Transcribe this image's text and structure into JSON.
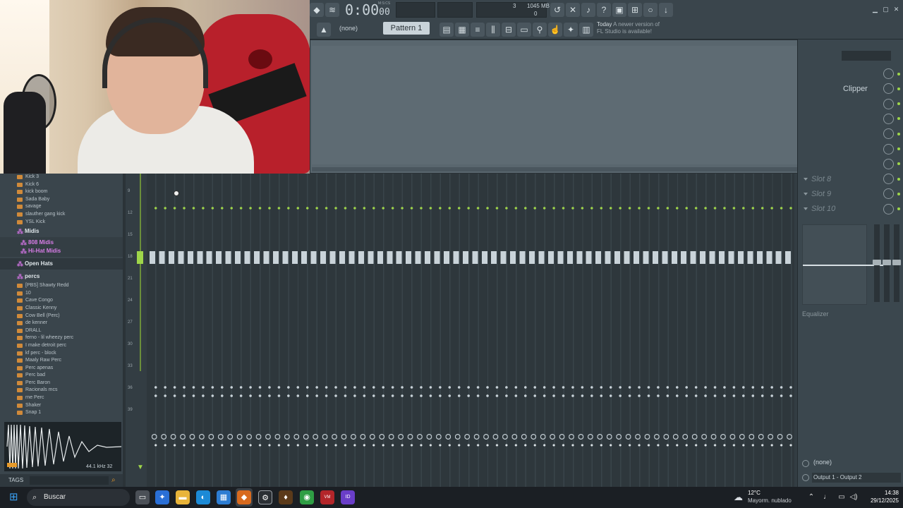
{
  "toolbar": {
    "time_main": "0:00",
    "time_sub": "00",
    "time_unit": "M:S:CS",
    "cpu": "3",
    "memory": "1045 MB",
    "voices": "0",
    "pattern_none": "(none)",
    "pattern_label": "Pattern 1",
    "news_when": "Today",
    "news_text": "A newer version of FL Studio is available!"
  },
  "browser": {
    "items_top": [
      "Kick 3",
      "Kick 6",
      "kick boom",
      "Sada Baby",
      "savage",
      "slauther gang kick",
      "YSL Kick"
    ],
    "folder_midis": "Midis",
    "sub_808": "808 Midis",
    "sub_hihat": "Hi-Hat Midis",
    "folder_open_hats": "Open Hats",
    "folder_percs": "percs",
    "items_percs": [
      "[PBS] Shawty Redd",
      "10",
      "Cave Congo",
      "Classic Kenny",
      "Cow Bell (Perc)",
      "de kenner",
      "DRALL",
      "ferno - lil wheezy perc",
      "I make detroit perc",
      "kf perc - block",
      "Maaly Raw Perc",
      "Perc apenas",
      "Perc bad",
      "Perc Baron",
      "Racionals mcs",
      "rne Perc",
      "Shaker",
      "Snap 1"
    ],
    "wave_info": "44.1 kHz 32",
    "tags_label": "TAGS"
  },
  "steps": {
    "row_numbers": [
      "9",
      "12",
      "15",
      "18",
      "21",
      "24",
      "27",
      "30",
      "33",
      "36",
      "39"
    ]
  },
  "mixer_right": {
    "slots": [
      {
        "label": ""
      },
      {
        "label": "Clipper"
      },
      {
        "label": ""
      },
      {
        "label": ""
      },
      {
        "label": ""
      },
      {
        "label": ""
      },
      {
        "label": ""
      },
      {
        "label": "Slot 8"
      },
      {
        "label": "Slot 9"
      },
      {
        "label": "Slot 10"
      }
    ],
    "eq_label": "Equalizer",
    "input_none": "(none)",
    "output": "Output 1 - Output 2"
  },
  "taskbar": {
    "search": "Buscar",
    "temp": "12°C",
    "weather": "Mayorm. nublado",
    "time": "14:38",
    "date": "29/12/2025"
  },
  "colors": {
    "accent_green": "#9fd64a",
    "purple": "#c26fd4",
    "folder_orange": "#d08a3a"
  }
}
